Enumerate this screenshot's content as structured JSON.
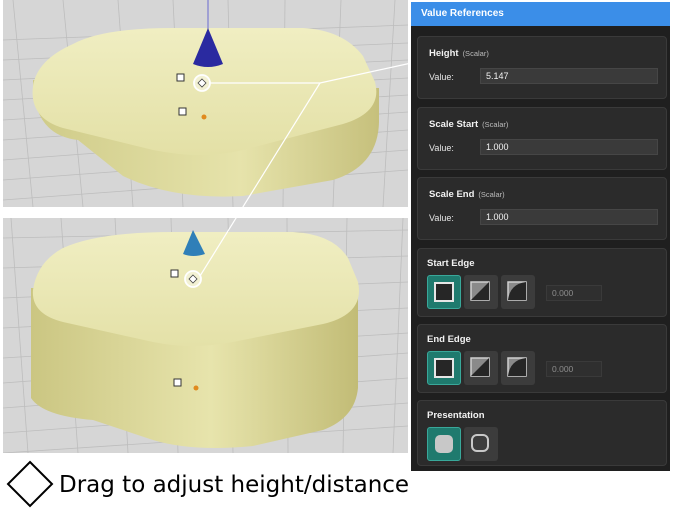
{
  "panel": {
    "title": "Value References",
    "accent_color": "#3b8ee8",
    "active_color": "#1f7a6e",
    "params": [
      {
        "name": "Height",
        "type": "(Scalar)",
        "value_label": "Value:",
        "value": "5.147"
      },
      {
        "name": "Scale Start",
        "type": "(Scalar)",
        "value_label": "Value:",
        "value": "1.000"
      },
      {
        "name": "Scale End",
        "type": "(Scalar)",
        "value_label": "Value:",
        "value": "1.000"
      }
    ],
    "start_edge": {
      "title": "Start Edge",
      "options": [
        "square-edge-icon",
        "chamfer-edge-icon",
        "fillet-edge-icon"
      ],
      "selected": "square-edge-icon",
      "value": "0.000"
    },
    "end_edge": {
      "title": "End Edge",
      "options": [
        "square-edge-icon",
        "chamfer-edge-icon",
        "fillet-edge-icon"
      ],
      "selected": "square-edge-icon",
      "value": "0.000"
    },
    "presentation": {
      "title": "Presentation",
      "options": [
        "solid-presentation-icon",
        "outline-presentation-icon"
      ],
      "selected": "solid-presentation-icon"
    }
  },
  "viewports": {
    "box_color": "#e9e5a9",
    "grid_color": "#d4d4d4",
    "gizmo_top": {
      "icon": "height-arrow-cone-icon",
      "color": "#2a2aa0"
    },
    "gizmo_bottom": {
      "icon": "height-arrow-cone-icon",
      "color": "#2f7fb8"
    }
  },
  "caption": {
    "icon": "diamond-handle-icon",
    "text": "Drag to adjust height/distance"
  }
}
